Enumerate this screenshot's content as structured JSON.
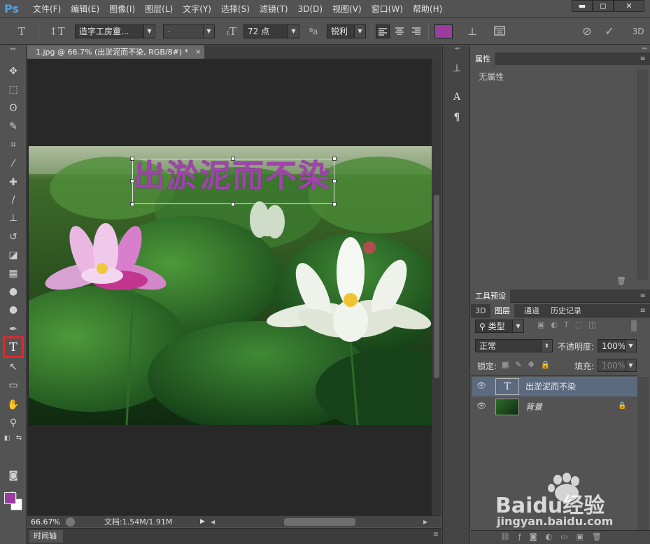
{
  "app": {
    "logo": "Ps"
  },
  "menu": [
    "文件(F)",
    "编辑(E)",
    "图像(I)",
    "图层(L)",
    "文字(Y)",
    "选择(S)",
    "滤镜(T)",
    "3D(D)",
    "视图(V)",
    "窗口(W)",
    "帮助(H)"
  ],
  "window_controls": {
    "minimize": "▬",
    "maximize": "◻",
    "close": "✕"
  },
  "options": {
    "font_family": "造字工房童...",
    "font_style": "-",
    "font_size": "72 点",
    "antialias_icon": "ªa",
    "antialias": "锐利",
    "text_color": "#9a3d9e",
    "cancel_icon": "⊘",
    "commit_icon": "✓",
    "three_d": "3D"
  },
  "document": {
    "tab_title": "1.jpg @ 66.7% (出淤泥而不染, RGB/8#) *",
    "close": "×",
    "canvas_text": "出淤泥而不染",
    "zoom": "66.67%",
    "doc_size": "文档:1.54M/1.91M"
  },
  "timeline": {
    "label": "时间轴"
  },
  "properties": {
    "title": "属性",
    "empty_message": "无属性"
  },
  "layers_panel": {
    "tool_presets_tab": "工具预设",
    "tabs": [
      "3D",
      "图层",
      "通道",
      "历史记录"
    ],
    "filter_kind": "类型",
    "blend_mode": "正常",
    "opacity_label": "不透明度:",
    "opacity": "100%",
    "lock_label": "锁定:",
    "fill_label": "填充:",
    "fill": "100%",
    "layers": [
      {
        "name": "出淤泥而不染",
        "type": "text",
        "selected": true
      },
      {
        "name": "背景",
        "type": "image",
        "selected": false
      }
    ]
  },
  "toolbar": {
    "fg_color": "#9a3d9e",
    "bg_color": "#ffffff"
  },
  "watermark": {
    "brand": "Baidu经验",
    "url": "jingyan.baidu.com"
  }
}
